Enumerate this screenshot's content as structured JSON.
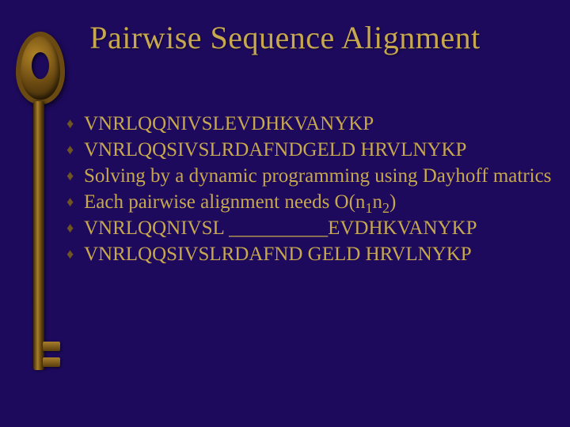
{
  "title": "Pairwise Sequence Alignment",
  "bullet_glyph": "♦",
  "bullets": [
    {
      "text": "VNRLQQNIVSLEVDHKVANYKP"
    },
    {
      "text": "VNRLQQSIVSLRDAFNDGELD HRVLNYKP"
    },
    {
      "text": "Solving by a dynamic programming using Dayhoff matrics"
    },
    {
      "pre": "Each pairwise alignment needs O(n",
      "s1": "1",
      "mid": "n",
      "s2": "2",
      "post": ")"
    },
    {
      "text": "VNRLQQNIVSL __________EVDHKVANYKP"
    },
    {
      "text": "VNRLQQSIVSLRDAFND GELD HRVLNYKP"
    }
  ]
}
